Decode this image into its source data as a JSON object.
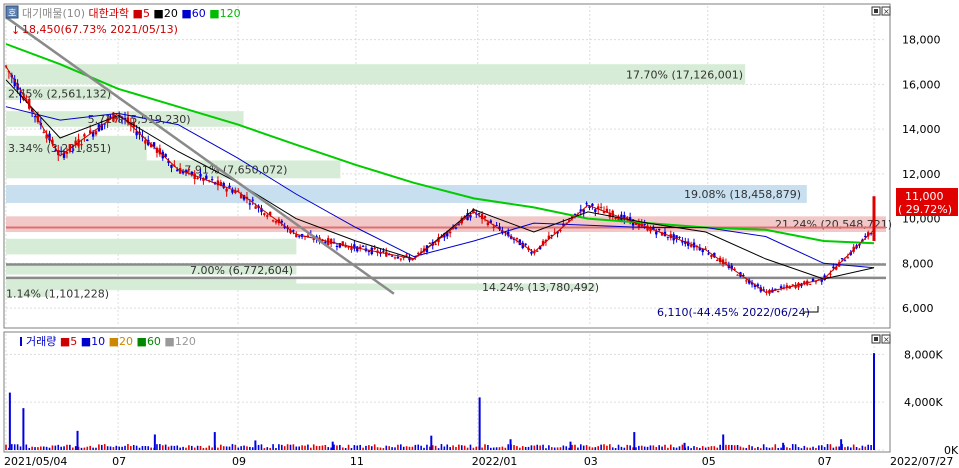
{
  "price_panel": {
    "legend": [
      {
        "text": "대기매물(10)",
        "color": "#8a8a8a"
      },
      {
        "text": "대한과학",
        "color": "#cc0000"
      },
      {
        "text": "5",
        "color": "#cc0000"
      },
      {
        "text": "20",
        "color": "#000000"
      },
      {
        "text": "60",
        "color": "#0000cc"
      },
      {
        "text": "120",
        "color": "#00bb00"
      }
    ],
    "max_label": "18,450(67.73% 2021/05/13)",
    "min_label": "6,110(-44.45% 2022/06/24)",
    "current_price": "11,000",
    "current_change": "( 29.72%)",
    "y_ticks": [
      {
        "value": 6000,
        "label": "6,000"
      },
      {
        "value": 8000,
        "label": "8,000"
      },
      {
        "value": 10000,
        "label": "10,000"
      },
      {
        "value": 12000,
        "label": "12,000"
      },
      {
        "value": 14000,
        "label": "14,000"
      },
      {
        "value": 16000,
        "label": "16,000"
      },
      {
        "value": 18000,
        "label": "18,000"
      }
    ]
  },
  "volume_panel": {
    "legend": [
      {
        "text": "거래량",
        "color": "#0000cc"
      },
      {
        "text": "5",
        "color": "#cc0000"
      },
      {
        "text": "10",
        "color": "#0000cc"
      },
      {
        "text": "20",
        "color": "#cc8800"
      },
      {
        "text": "60",
        "color": "#008800"
      },
      {
        "text": "120",
        "color": "#999999"
      }
    ],
    "y_ticks": [
      {
        "value": 0,
        "label": "0K"
      },
      {
        "value": 4000,
        "label": "4,000K"
      },
      {
        "value": 8000,
        "label": "8,000K"
      }
    ]
  },
  "x_axis": {
    "labels": [
      {
        "label": "2021/05/04",
        "date": "2021-05-04"
      },
      {
        "label": "07",
        "date": "2021-07-01"
      },
      {
        "label": "09",
        "date": "2021-09-01"
      },
      {
        "label": "11",
        "date": "2021-11-01"
      },
      {
        "label": "2022/01",
        "date": "2022-01-03"
      },
      {
        "label": "03",
        "date": "2022-03-02"
      },
      {
        "label": "05",
        "date": "2022-05-02"
      },
      {
        "label": "07",
        "date": "2022-07-01"
      },
      {
        "label": "2022/07/27",
        "date": "2022-07-27"
      }
    ]
  },
  "chart_data": {
    "type": "candlestick",
    "title": "대한과학",
    "x_range": [
      "2021-05-04",
      "2022-07-27"
    ],
    "ylim": [
      5200,
      19500
    ],
    "volume_ylim": [
      0,
      9200
    ],
    "volume_profile": [
      {
        "low": 7000,
        "high": 7300,
        "pct": "",
        "volume": ""
      },
      {
        "low": 7500,
        "high": 7900,
        "pct": "7.00%",
        "volume": "(6,772,604)",
        "label": "7.00% (6,772,604)"
      },
      {
        "low": 8400,
        "high": 9100,
        "pct": "",
        "volume": ""
      },
      {
        "low": 9400,
        "high": 10100,
        "pct": "21.24%",
        "volume": "(20,548,721)",
        "label": "21.24% (20,548,721)"
      },
      {
        "low": 10700,
        "high": 11500,
        "pct": "19.08%",
        "volume": "(18,458,879)",
        "label": "19.08% (18,458,879)"
      },
      {
        "low": 11800,
        "high": 12600,
        "pct": "7.91%",
        "volume": "(7,650,072)",
        "label": "7.91% (7,650,072)"
      },
      {
        "low": 12600,
        "high": 13700,
        "pct": "3.34%",
        "volume": "(3,231,851)",
        "label": "3.34% (3,231,851)"
      },
      {
        "low": 14100,
        "high": 14800,
        "pct": "5.71%",
        "volume": "(5,519,230)",
        "label": "5.71% (5,519,230)"
      },
      {
        "low": 15300,
        "high": 15900,
        "pct": "2.65%",
        "volume": "(2,561,132)",
        "label": "2.65% (2,561,132)"
      },
      {
        "low": 16000,
        "high": 16900,
        "pct": "17.70%",
        "volume": "(17,126,001)",
        "label": "17.70% (17,126,001)"
      },
      {
        "low": 6800,
        "high": 7100,
        "pct": "14.24%",
        "volume": "(13,780,492)",
        "label": "14.24% (13,780,492)"
      },
      {
        "low": 6500,
        "high": 6800,
        "pct": "1.14%",
        "volume": "(1,101,228)",
        "label": "1.14% (1,101,228)"
      }
    ],
    "trendline": [
      {
        "date": "2021-05-04",
        "value": 19000
      },
      {
        "date": "2021-12-01",
        "value": 7000
      }
    ],
    "horizontal_lines": [
      7950,
      7350,
      9600
    ],
    "series": [
      {
        "name": "120",
        "color": "#00cc00",
        "points": [
          [
            "2021-05-04",
            17800
          ],
          [
            "2021-06-01",
            16900
          ],
          [
            "2021-07-01",
            15800
          ],
          [
            "2021-08-01",
            15000
          ],
          [
            "2021-09-01",
            14200
          ],
          [
            "2021-10-01",
            13300
          ],
          [
            "2021-11-01",
            12400
          ],
          [
            "2021-12-01",
            11600
          ],
          [
            "2022-01-01",
            10900
          ],
          [
            "2022-02-01",
            10500
          ],
          [
            "2022-03-01",
            10000
          ],
          [
            "2022-04-01",
            9800
          ],
          [
            "2022-05-01",
            9600
          ],
          [
            "2022-06-01",
            9500
          ],
          [
            "2022-07-01",
            9000
          ],
          [
            "2022-07-27",
            8900
          ]
        ]
      },
      {
        "name": "60",
        "color": "#0000cc",
        "points": [
          [
            "2021-05-04",
            15000
          ],
          [
            "2021-06-01",
            14400
          ],
          [
            "2021-07-01",
            14700
          ],
          [
            "2021-08-01",
            14200
          ],
          [
            "2021-09-01",
            12700
          ],
          [
            "2021-10-01",
            11100
          ],
          [
            "2021-11-01",
            9600
          ],
          [
            "2021-12-01",
            8300
          ],
          [
            "2022-01-01",
            9000
          ],
          [
            "2022-02-01",
            9800
          ],
          [
            "2022-03-01",
            9700
          ],
          [
            "2022-04-01",
            9600
          ],
          [
            "2022-05-01",
            9600
          ],
          [
            "2022-06-01",
            9200
          ],
          [
            "2022-07-01",
            8000
          ],
          [
            "2022-07-27",
            7800
          ]
        ]
      },
      {
        "name": "20",
        "color": "#000000",
        "points": [
          [
            "2021-05-04",
            16200
          ],
          [
            "2021-06-01",
            13600
          ],
          [
            "2021-07-01",
            14600
          ],
          [
            "2021-08-01",
            13000
          ],
          [
            "2021-09-01",
            11600
          ],
          [
            "2021-10-01",
            10000
          ],
          [
            "2021-11-01",
            9000
          ],
          [
            "2021-12-01",
            8200
          ],
          [
            "2022-01-01",
            10400
          ],
          [
            "2022-02-01",
            9400
          ],
          [
            "2022-03-01",
            10300
          ],
          [
            "2022-04-01",
            9800
          ],
          [
            "2022-05-01",
            9400
          ],
          [
            "2022-06-01",
            8200
          ],
          [
            "2022-07-01",
            7300
          ],
          [
            "2022-07-27",
            7800
          ]
        ]
      },
      {
        "name": "5",
        "color": "#cc0000",
        "points": [
          [
            "2021-05-04",
            16800
          ],
          [
            "2021-06-01",
            12800
          ],
          [
            "2021-07-01",
            14700
          ],
          [
            "2021-08-01",
            12200
          ],
          [
            "2021-09-01",
            11200
          ],
          [
            "2021-10-01",
            9300
          ],
          [
            "2021-11-01",
            8700
          ],
          [
            "2021-12-01",
            8200
          ],
          [
            "2022-01-01",
            10300
          ],
          [
            "2022-02-01",
            8500
          ],
          [
            "2022-03-01",
            10600
          ],
          [
            "2022-04-01",
            9600
          ],
          [
            "2022-05-01",
            8600
          ],
          [
            "2022-06-01",
            6700
          ],
          [
            "2022-07-01",
            7300
          ],
          [
            "2022-07-27",
            9500
          ]
        ]
      }
    ],
    "volume_spikes": [
      [
        "2021-05-06",
        4800
      ],
      [
        "2021-05-13",
        3500
      ],
      [
        "2021-06-10",
        1600
      ],
      [
        "2021-07-20",
        1300
      ],
      [
        "2021-08-20",
        1500
      ],
      [
        "2021-09-10",
        800
      ],
      [
        "2021-10-20",
        700
      ],
      [
        "2021-12-10",
        1200
      ],
      [
        "2022-01-04",
        4400
      ],
      [
        "2022-01-20",
        900
      ],
      [
        "2022-02-20",
        700
      ],
      [
        "2022-03-25",
        1500
      ],
      [
        "2022-04-20",
        600
      ],
      [
        "2022-05-10",
        1300
      ],
      [
        "2022-06-10",
        600
      ],
      [
        "2022-07-10",
        900
      ],
      [
        "2022-07-27",
        8100
      ]
    ]
  }
}
